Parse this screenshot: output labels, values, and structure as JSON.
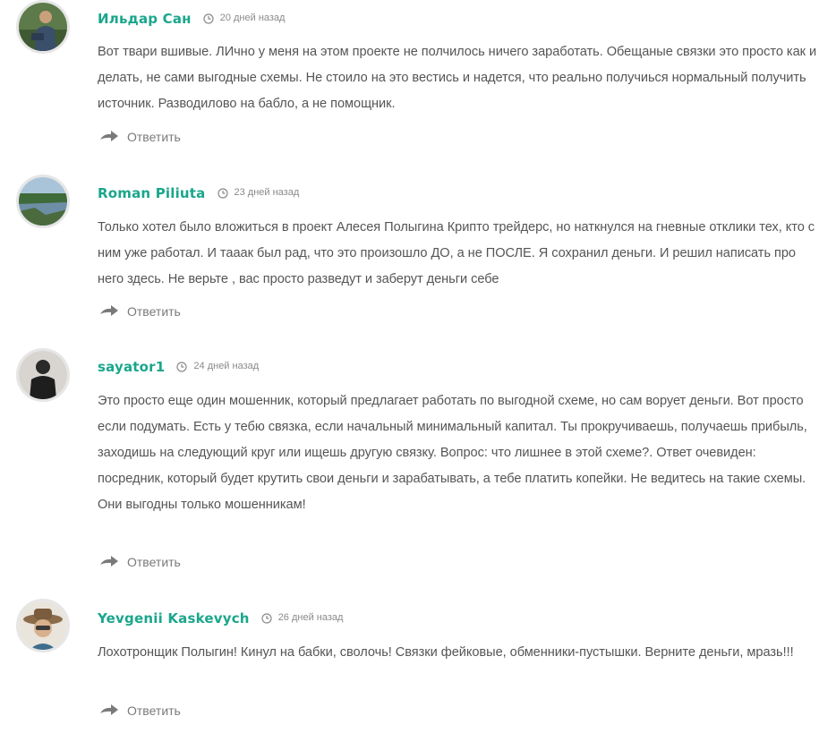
{
  "comments": [
    {
      "author": "Ильдар Сан",
      "date": "20 дней назад",
      "text": "Вот твари вшивые. ЛИчно у меня на этом проекте не полчилось ничего заработать. Обещаные связки это просто как и делать, не сами выгодные схемы. Не стоило на это вестись и надется, что реально получиься нормальный получить источник. Разводилово на бабло, а не помощник.",
      "reply_label": "Ответить"
    },
    {
      "author": "Roman Piliuta",
      "date": "23 дней назад",
      "text": "Только хотел было вложиться в проект Алесея Полыгина Крипто трейдерс, но наткнулся на гневные отклики тех, кто с ним уже работал. И тааак был рад, что это произошло ДО, а не ПОСЛЕ. Я сохранил деньги. И решил написать про него здесь. Не верьте , вас просто разведут и заберут деньги себе",
      "reply_label": "Ответить"
    },
    {
      "author": "sayator1",
      "date": "24 дней назад",
      "text": "Это просто еще один мошенник, который предлагает работать по выгодной схеме, но сам ворует деньги. Вот просто если подумать. Есть у тебю связка, если начальный минимальный капитал. Ты прокручиваешь, получаешь прибыль, заходишь на следующий круг или ищешь другую связку. Вопрос: что лишнее в этой схеме?. Ответ очевиден: посредник, который будет крутить свои деньги и зарабатывать, а тебе платить копейки. Не ведитесь на такие схемы. Они выгодны только мошенникам!",
      "reply_label": "Ответить"
    },
    {
      "author": "Yevgenii Kaskevych",
      "date": "26 дней назад",
      "text": "Лохотронщик Полыгин! Кинул на бабки, сволочь! Связки фейковые, обменники-пустышки. Верните деньги, мразь!!!",
      "reply_label": "Ответить"
    }
  ],
  "colors": {
    "author": "#1aa68c",
    "text": "#555555",
    "meta": "#8a8a8a",
    "avatar_border": "#e6e6e6"
  },
  "icons": {
    "date": "clock-icon",
    "reply": "reply-arrow-icon"
  }
}
